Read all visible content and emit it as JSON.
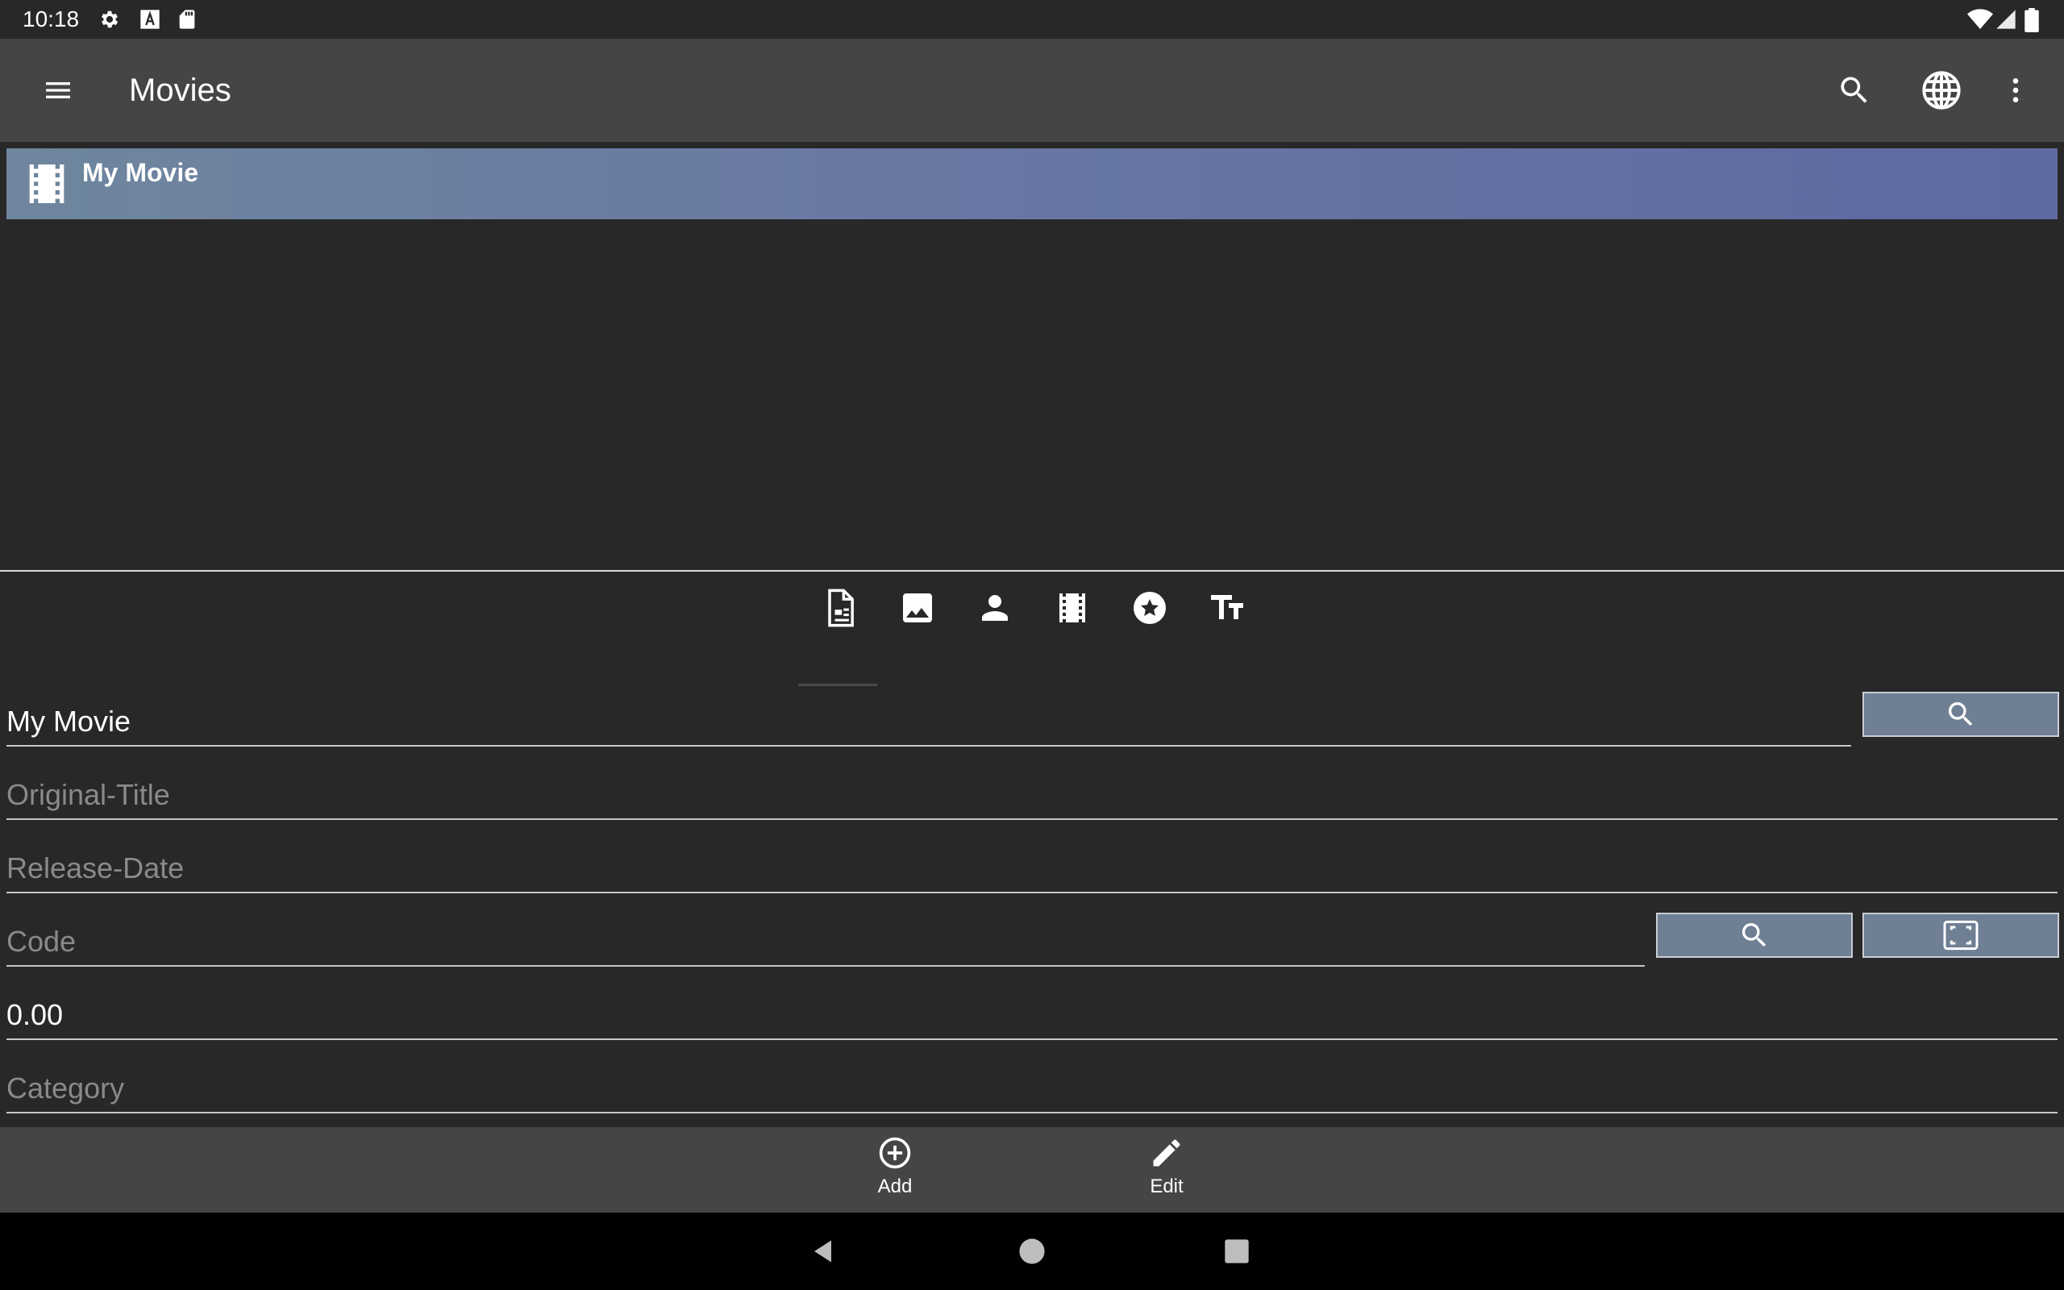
{
  "status_bar": {
    "time": "10:18",
    "left_icons": [
      "settings-icon",
      "a-notification-icon",
      "sd-card-icon"
    ],
    "right_icons": [
      "wifi-icon",
      "signal-icon",
      "battery-icon"
    ]
  },
  "app_bar": {
    "title": "Movies",
    "icons": [
      "menu-icon",
      "search-icon",
      "globe-icon",
      "more-vert-icon"
    ]
  },
  "list": {
    "items": [
      {
        "label": "My Movie",
        "icon": "film-icon",
        "selected": true
      }
    ]
  },
  "detail_tabs": {
    "icons": [
      "document-icon",
      "image-icon",
      "person-icon",
      "film-strip-icon",
      "star-icon",
      "text-size-icon"
    ],
    "active_index": 0
  },
  "form": {
    "title": {
      "value": "My Movie",
      "placeholder": ""
    },
    "original_title": {
      "value": "",
      "placeholder": "Original-Title"
    },
    "release_date": {
      "value": "",
      "placeholder": "Release-Date"
    },
    "code": {
      "value": "",
      "placeholder": "Code"
    },
    "rating": {
      "value": "0.00",
      "placeholder": ""
    },
    "category": {
      "value": "",
      "placeholder": "Category"
    }
  },
  "bottom_actions": {
    "add_label": "Add",
    "edit_label": "Edit"
  },
  "colors": {
    "background": "#282828",
    "app_bar": "#454545",
    "selected_item_start": "#6f869e",
    "selected_item_end": "#5e6aa1",
    "button_fill": "#6f7f94"
  }
}
